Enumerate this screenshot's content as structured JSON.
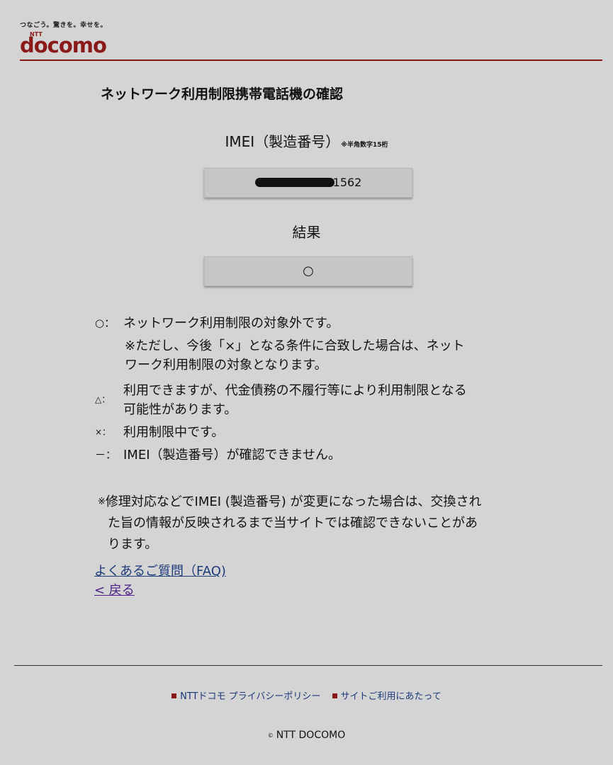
{
  "header": {
    "tagline": "つなごう。驚きを。幸せを。",
    "logo_ntt": "NTT",
    "logo_text": "docomo"
  },
  "page": {
    "title": "ネットワーク利用制限携帯電話機の確認"
  },
  "imei": {
    "label": "IMEI（製造番号）",
    "note": "※半角数字15桁",
    "value_visible_suffix": "1562"
  },
  "result": {
    "label": "結果",
    "value": "○"
  },
  "legend": {
    "circle": {
      "symbol": "○：",
      "text": "ネットワーク利用制限の対象外です。",
      "note_line1": "※ただし、今後「×」となる条件に合致した場合は、ネット",
      "note_line2": "ワーク利用制限の対象となります。"
    },
    "triangle": {
      "symbol": "△：",
      "text_line1": "利用できますが、代金債務の不履行等により利用制限となる",
      "text_line2": "可能性があります。"
    },
    "cross": {
      "symbol": "×：",
      "text": "利用制限中です。"
    },
    "dash": {
      "symbol": "－：",
      "text": "IMEI（製造番号）が確認できません。"
    }
  },
  "note": {
    "mark": "※",
    "line1": "修理対応などでIMEI (製造番号) が変更になった場合は、交換され",
    "line2": "た旨の情報が反映されるまで当サイトでは確認できないことがあ",
    "line3": "ります。"
  },
  "links": {
    "faq": "よくあるご質問（FAQ)",
    "back": "< 戻る"
  },
  "footer": {
    "privacy": "NTTドコモ プライバシーポリシー",
    "terms": "サイトご利用にあたって",
    "copyright_symbol": "©",
    "copyright": "NTT DOCOMO"
  },
  "colors": {
    "brand": "#8a1a1a",
    "link": "#1d3a7a",
    "visited_link": "#4b1f86",
    "background": "#d4d4d4"
  }
}
